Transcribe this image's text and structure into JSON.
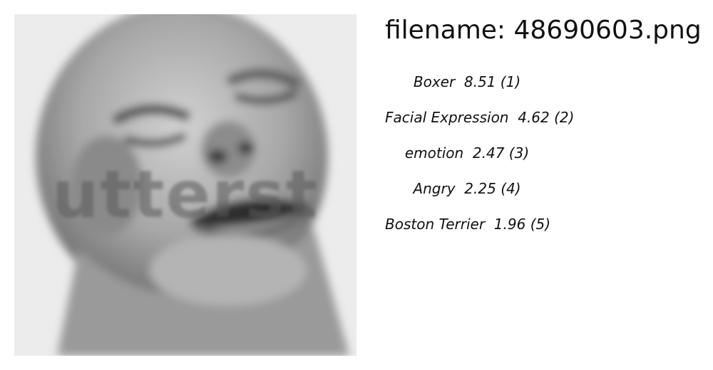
{
  "image": {
    "description_icon": "grayscale-face-photo",
    "watermark_text": "utterst",
    "colors": {
      "background": "#e9e9e9",
      "skin_light": "#c8c8c8",
      "skin_dark": "#6a6a6a"
    }
  },
  "header": {
    "filename_text": "filename: 48690603.png"
  },
  "predictions": [
    {
      "label": "Boxer",
      "score": "8.51",
      "rank": "(1)"
    },
    {
      "label": "Facial Expression",
      "score": "4.62",
      "rank": "(2)"
    },
    {
      "label": "emotion",
      "score": "2.47",
      "rank": "(3)"
    },
    {
      "label": "Angry",
      "score": "2.25",
      "rank": "(4)"
    },
    {
      "label": "Boston Terrier",
      "score": "1.96",
      "rank": "(5)"
    }
  ]
}
